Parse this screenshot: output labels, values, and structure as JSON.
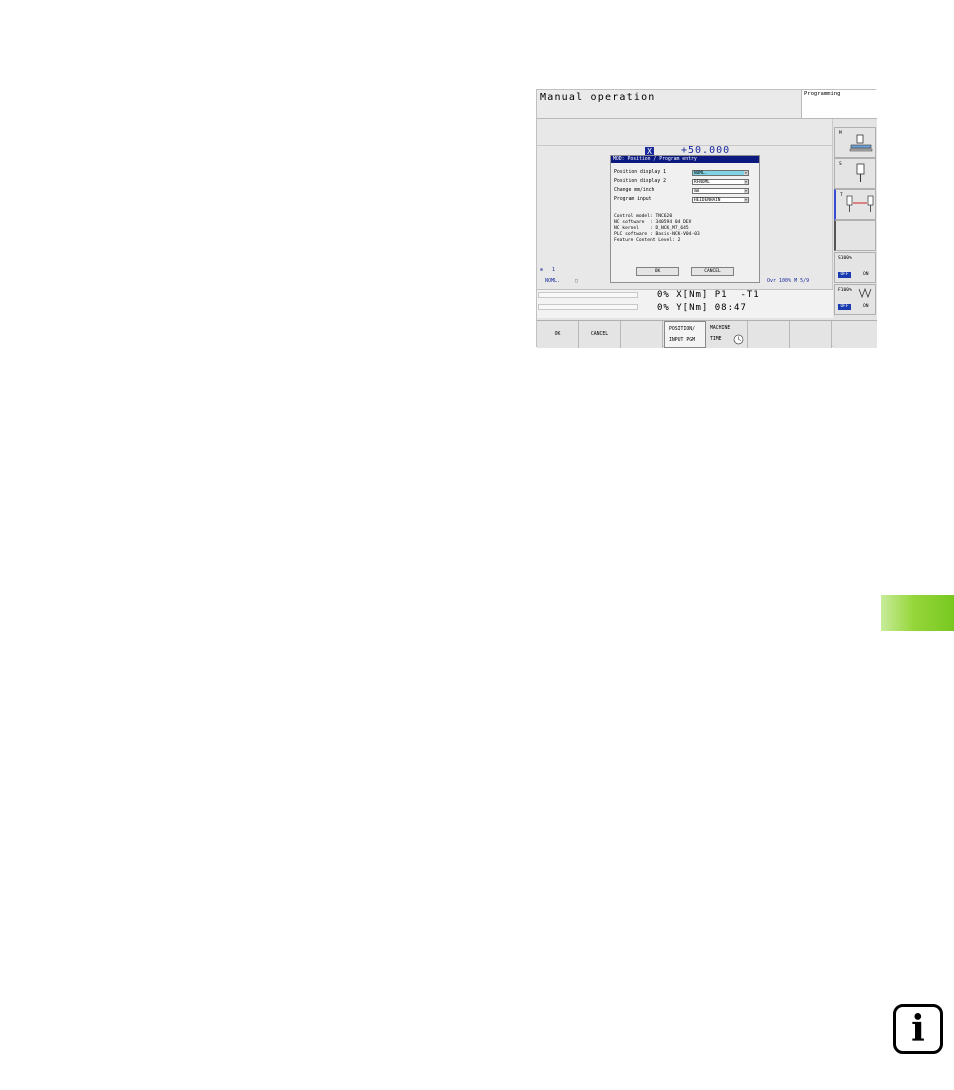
{
  "header": {
    "mode_title": "Manual operation",
    "prog_label": "Programming"
  },
  "position": {
    "axis": "X",
    "value": "+50.000"
  },
  "dialog": {
    "title": "MOD: Position / Program entry",
    "rows": [
      {
        "label": "Position display 1",
        "value": "NOML."
      },
      {
        "label": "Position display 2",
        "value": "RFNOML"
      },
      {
        "label": "Change mm/inch",
        "value": "mm"
      },
      {
        "label": "Program input",
        "value": "HEIDENHAIN"
      }
    ],
    "info": [
      "Control model: TNC620",
      "NC software  : 340594 04 DEV",
      "NC kernel    : D_NCK_M7_645",
      "PLC software : Basis-NCK-V04-03",
      "Feature Content Level: 2"
    ],
    "ok_label": "OK",
    "cancel_label": "CANCEL"
  },
  "status": {
    "tool_icon": "1",
    "mode": "NOML.",
    "right": "Ovr  100%  M 5/9",
    "line1": "0% X[Nm] P1  -T1",
    "line2": "0% Y[Nm] 08:47"
  },
  "softkeys": {
    "ok": "OK",
    "cancel": "CANCEL",
    "pos_l1": "POSITION/",
    "pos_l2": "INPUT PGM",
    "mt_l1": "MACHINE",
    "mt_l2": "TIME"
  },
  "side": {
    "m": "M",
    "s": "S",
    "t": "T",
    "s100": "S100%",
    "f100": "F100%",
    "off": "OFF",
    "on": "ON"
  },
  "icon": {
    "info": "i"
  }
}
